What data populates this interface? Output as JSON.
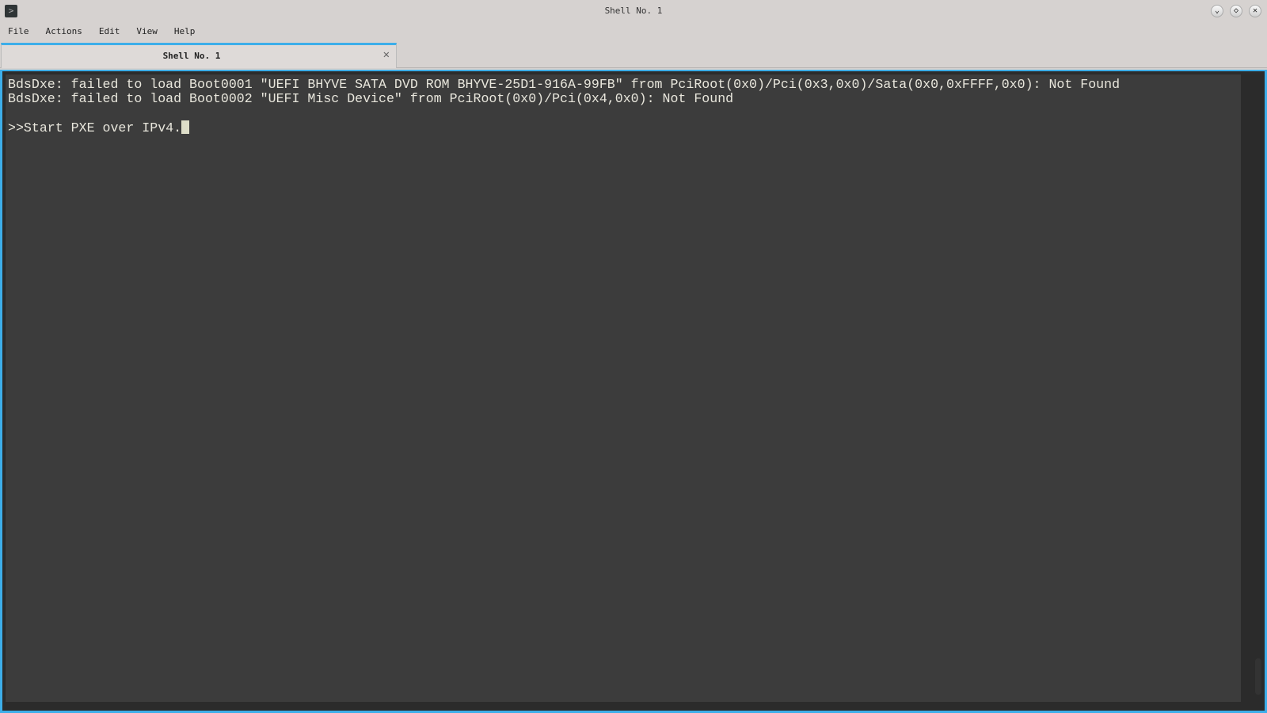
{
  "window": {
    "title": "Shell No. 1",
    "controls": [
      "minimize",
      "maximize",
      "close"
    ]
  },
  "menu": [
    "File",
    "Actions",
    "Edit",
    "View",
    "Help"
  ],
  "tab": {
    "label": "Shell No. 1"
  },
  "terminal": {
    "lines": [
      "BdsDxe: failed to load Boot0001 \"UEFI BHYVE SATA DVD ROM BHYVE-25D1-916A-99FB\" from PciRoot(0x0)/Pci(0x3,0x0)/Sata(0x0,0xFFFF,0x0): Not Found",
      "BdsDxe: failed to load Boot0002 \"UEFI Misc Device\" from PciRoot(0x0)/Pci(0x4,0x0): Not Found",
      "",
      ">>Start PXE over IPv4."
    ]
  },
  "colors": {
    "accent": "#3daee9",
    "terminal_bg": "#3c3c3c",
    "terminal_fg": "#e8e6dc"
  }
}
